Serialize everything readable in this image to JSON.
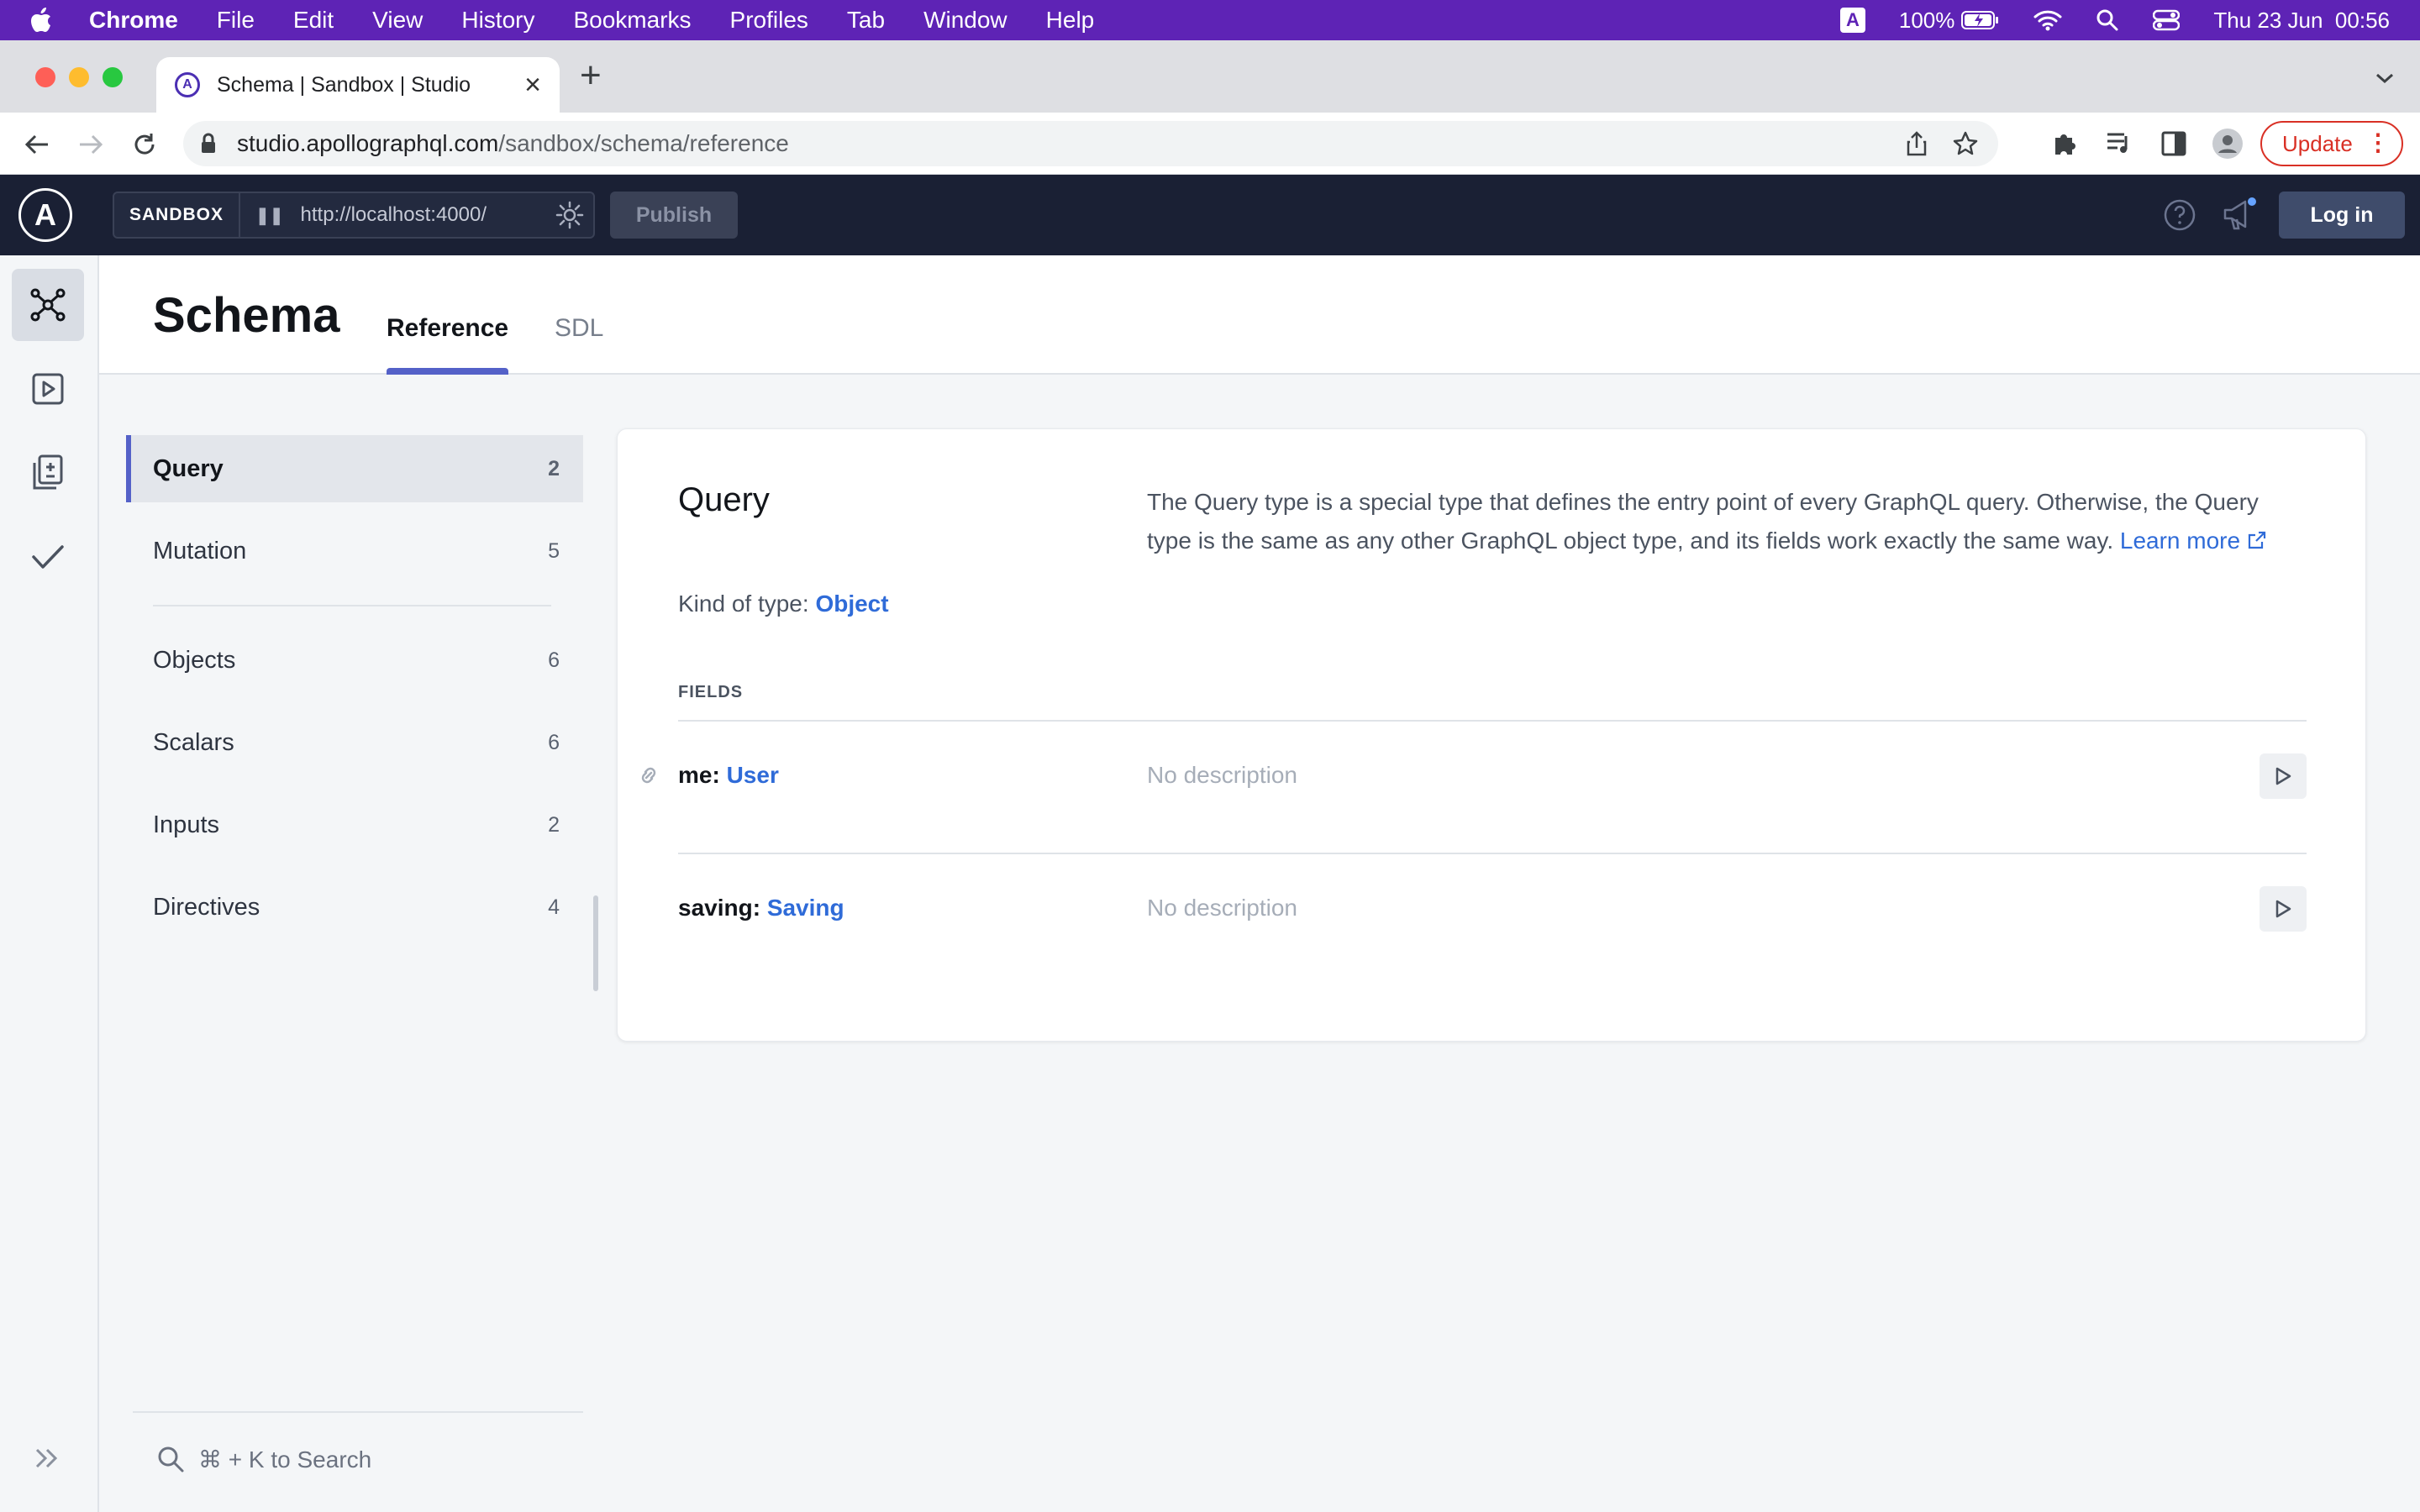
{
  "menubar": {
    "app": "Chrome",
    "items": [
      "File",
      "Edit",
      "View",
      "History",
      "Bookmarks",
      "Profiles",
      "Tab",
      "Window",
      "Help"
    ],
    "input_source": "A",
    "battery": "100%",
    "datetime": "Thu 23 Jun  00:56"
  },
  "browser": {
    "tab_title": "Schema | Sandbox | Studio",
    "url_host": "studio.apollographql.com",
    "url_path": "/sandbox/schema/reference",
    "update_label": "Update"
  },
  "apollo": {
    "logo_letter": "A",
    "sandbox_label": "SANDBOX",
    "endpoint": "http://localhost:4000/",
    "publish_label": "Publish",
    "login_label": "Log in"
  },
  "page": {
    "title": "Schema",
    "tabs": [
      {
        "label": "Reference",
        "active": true
      },
      {
        "label": "SDL",
        "active": false
      }
    ]
  },
  "sidenav": {
    "items": [
      {
        "label": "Query",
        "count": "2",
        "active": true
      },
      {
        "label": "Mutation",
        "count": "5"
      },
      {
        "label": "Objects",
        "count": "6"
      },
      {
        "label": "Scalars",
        "count": "6"
      },
      {
        "label": "Inputs",
        "count": "2"
      },
      {
        "label": "Directives",
        "count": "4"
      }
    ],
    "search_placeholder": "⌘ + K to Search"
  },
  "type_detail": {
    "name": "Query",
    "description": "The Query type is a special type that defines the entry point of every GraphQL query. Otherwise, the Query type is the same as any other GraphQL object type, and its fields work exactly the same way.",
    "learn_more": "Learn more",
    "kind_label": "Kind of type:",
    "kind_value": "Object",
    "fields_label": "FIELDS",
    "fields": [
      {
        "name": "me:",
        "type": "User",
        "description": "No description"
      },
      {
        "name": "saving:",
        "type": "Saving",
        "description": "No description"
      }
    ]
  },
  "colors": {
    "menubar": "#5e23b5",
    "apollo_header": "#1a2034",
    "accent": "#5461c8",
    "link": "#2f6bd8",
    "update": "#d93025"
  }
}
